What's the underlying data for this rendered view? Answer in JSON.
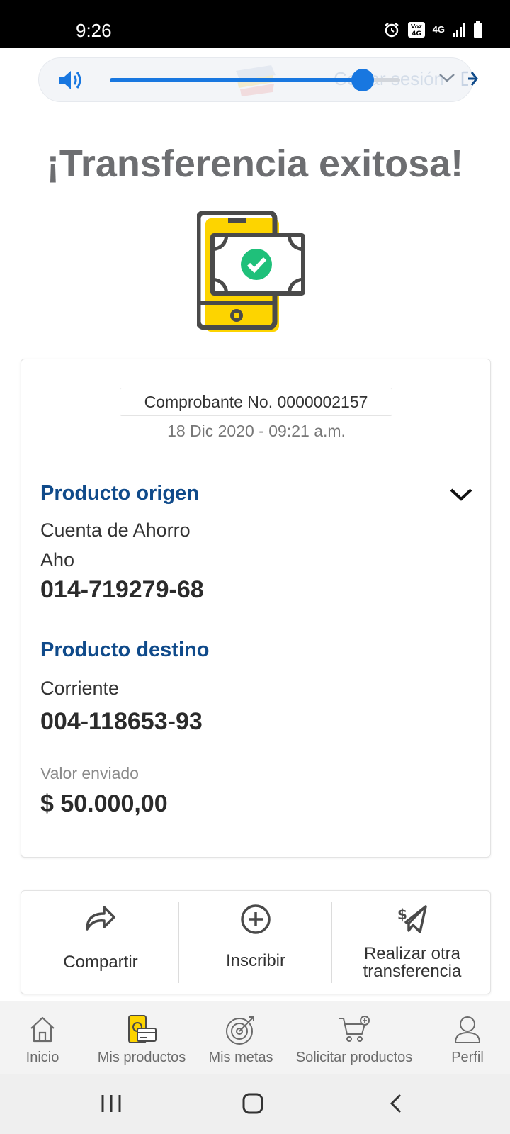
{
  "status_bar": {
    "time": "9:26",
    "net_label": "4G"
  },
  "header": {
    "logout_text": "Cerrar sesión",
    "volume_level_percent": 87
  },
  "title": "¡Transferencia exitosa!",
  "receipt": {
    "voucher": "Comprobante No. 0000002157",
    "datetime": "18 Dic 2020 - 09:21 a.m.",
    "origin": {
      "title": "Producto origen",
      "account_type": "Cuenta de Ahorro",
      "short_type": "Aho",
      "number": "014-719279-68"
    },
    "destination": {
      "title": "Producto destino",
      "account_type": "Corriente",
      "number": "004-118653-93"
    },
    "amount_label": "Valor enviado",
    "amount": "$ 50.000,00"
  },
  "actions": [
    {
      "label": "Compartir",
      "icon": "share-icon"
    },
    {
      "label": "Inscribir",
      "icon": "plus-circle-icon"
    },
    {
      "label_line1": "Realizar otra",
      "label_line2": "transferencia",
      "icon": "send-money-icon"
    }
  ],
  "bottom_nav": [
    {
      "label": "Inicio",
      "icon": "home-icon"
    },
    {
      "label": "Mis productos",
      "icon": "products-icon"
    },
    {
      "label": "Mis metas",
      "icon": "target-icon"
    },
    {
      "label": "Solicitar productos",
      "icon": "cart-icon"
    },
    {
      "label": "Perfil",
      "icon": "user-icon"
    }
  ],
  "colors": {
    "brand_blue": "#0f4a8a",
    "slider_blue": "#1877e0",
    "accent_yellow": "#fdd400",
    "success_green": "#1fc07a"
  }
}
